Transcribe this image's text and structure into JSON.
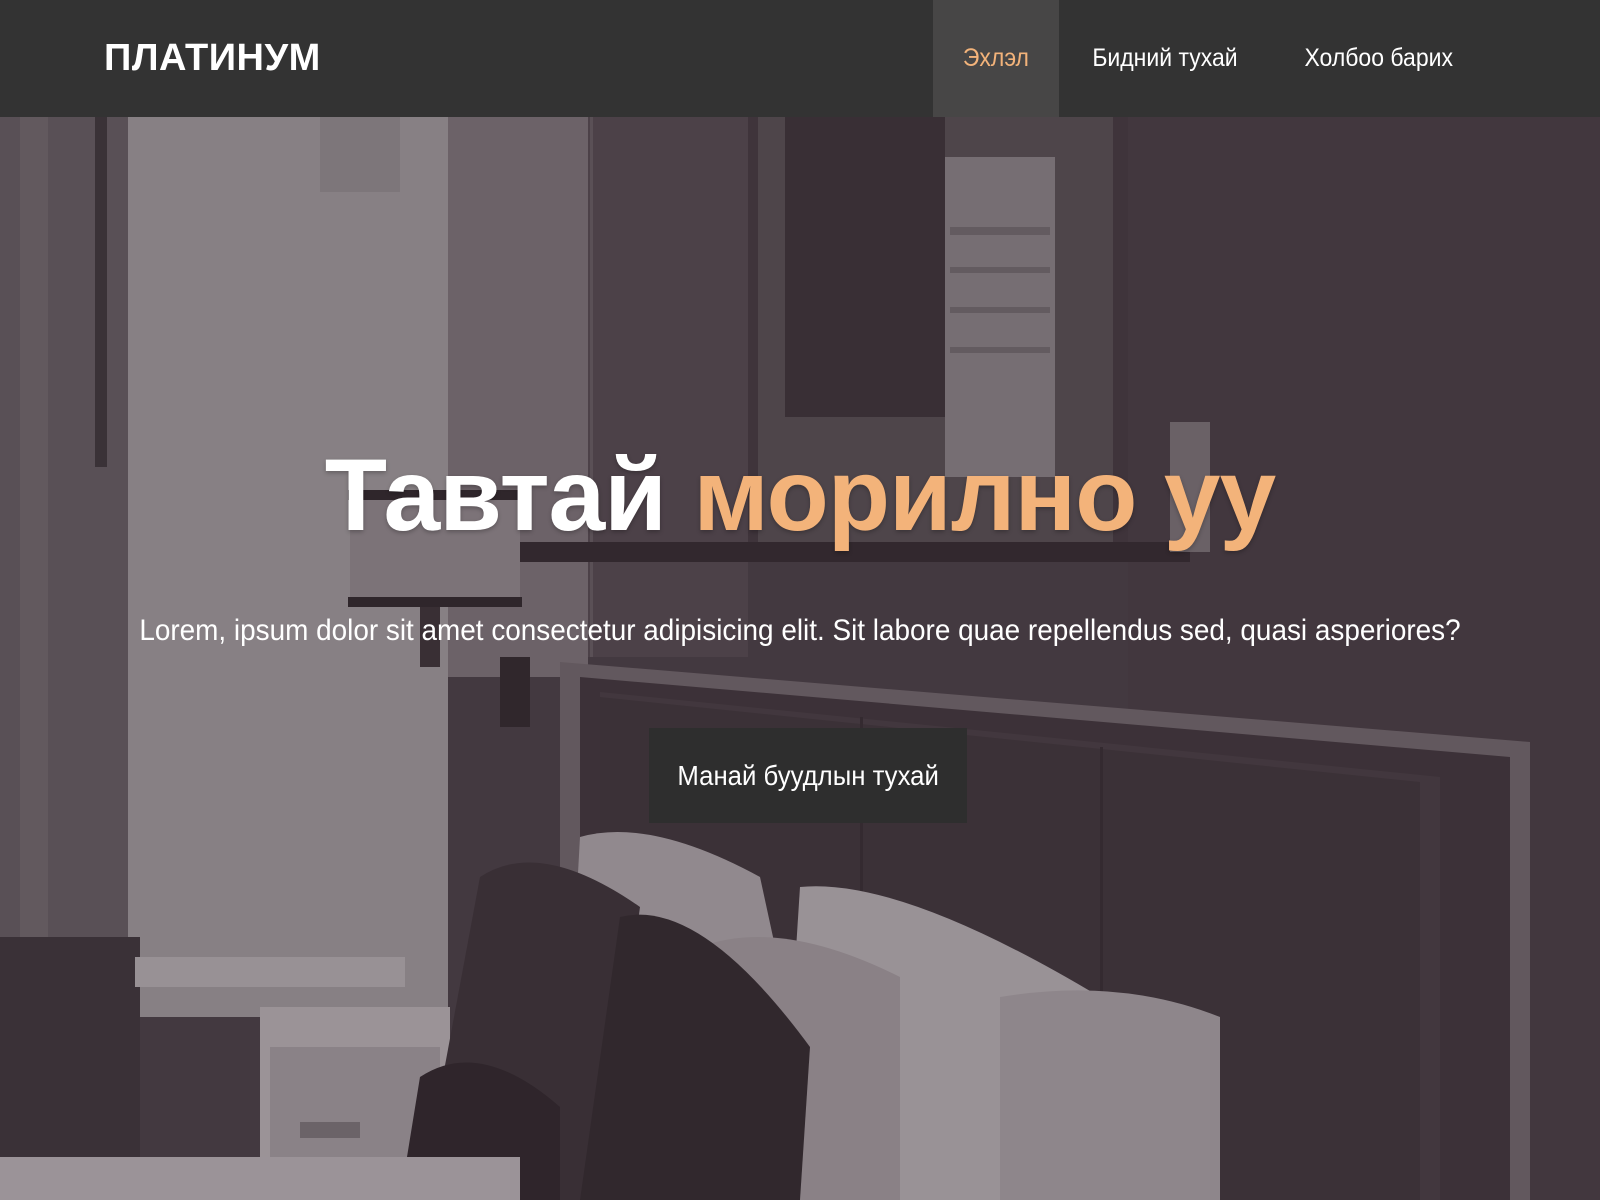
{
  "navbar": {
    "brand": "ПЛАТИНУМ",
    "items": [
      {
        "label": "Эхлэл",
        "active": true
      },
      {
        "label": "Бидний тухай",
        "active": false
      },
      {
        "label": "Холбоо барих",
        "active": false
      }
    ]
  },
  "hero": {
    "title_part1": "Тавтай",
    "title_part2": "морилно уу",
    "subtitle": "Lorem, ipsum dolor sit amet consectetur adipisicing elit. Sit labore quae repellendus sed, quasi asperiores?",
    "cta_label": "Манай буудлын тухай",
    "background": "hotel-bedroom-photo"
  },
  "colors": {
    "navbar_bg": "#333333",
    "nav_active_bg": "#474646",
    "accent": "#f3b37a",
    "text": "#ffffff",
    "button_bg": "#2e2e2e"
  }
}
